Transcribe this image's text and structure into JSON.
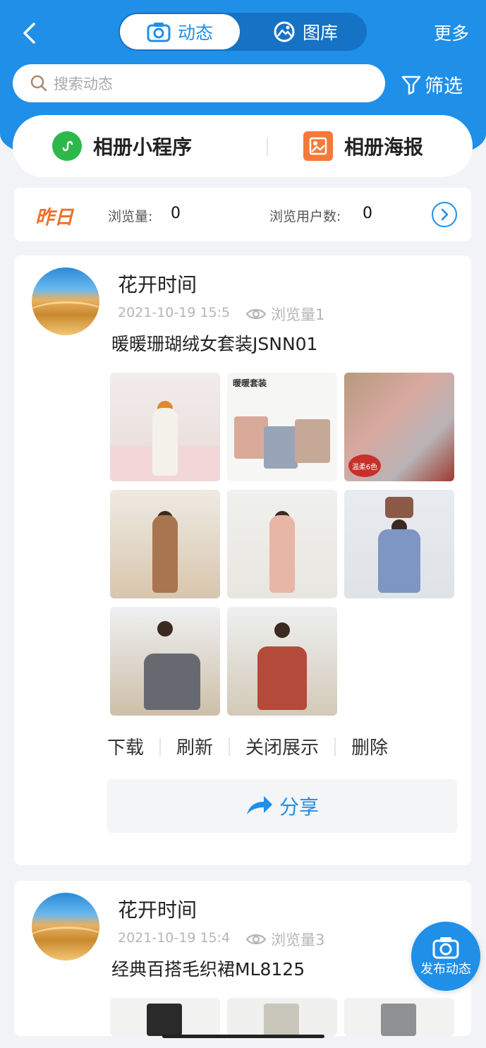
{
  "header": {
    "back_icon": "chevron-left-icon",
    "tabs": [
      {
        "label": "动态",
        "icon": "camera-icon",
        "active": true
      },
      {
        "label": "图库",
        "icon": "gallery-icon",
        "active": false
      }
    ],
    "more_label": "更多"
  },
  "search": {
    "placeholder": "搜索动态",
    "icon": "search-icon"
  },
  "filter": {
    "label": "筛选",
    "icon": "funnel-icon"
  },
  "mini_links": [
    {
      "label": "相册小程序",
      "icon": "mini-program-icon",
      "color": "#2db84b"
    },
    {
      "label": "相册海报",
      "icon": "poster-icon",
      "color": "#f47a3a"
    }
  ],
  "stats": {
    "badge": "昨日",
    "views_label": "浏览量:",
    "views_value": "0",
    "users_label": "浏览用户数:",
    "users_value": "0"
  },
  "posts": [
    {
      "author": "花开时间",
      "time": "2021-10-19 15:5",
      "views": "浏览量1",
      "title": "暖暖珊瑚绒女套装JSNN01",
      "actions": [
        "下载",
        "刷新",
        "关闭展示",
        "删除"
      ],
      "share_label": "分享",
      "photo_text": {
        "p2_title": "暖暖套装",
        "p3_badge": "温柔6色"
      }
    },
    {
      "author": "花开时间",
      "time": "2021-10-19 15:4",
      "views": "浏览量3",
      "title": "经典百搭毛织裙ML8125"
    }
  ],
  "fab": {
    "label": "发布动态",
    "icon": "camera-icon"
  },
  "colors": {
    "primary": "#1f8fe8",
    "accent_orange": "#f0702a",
    "green": "#2db84b"
  }
}
